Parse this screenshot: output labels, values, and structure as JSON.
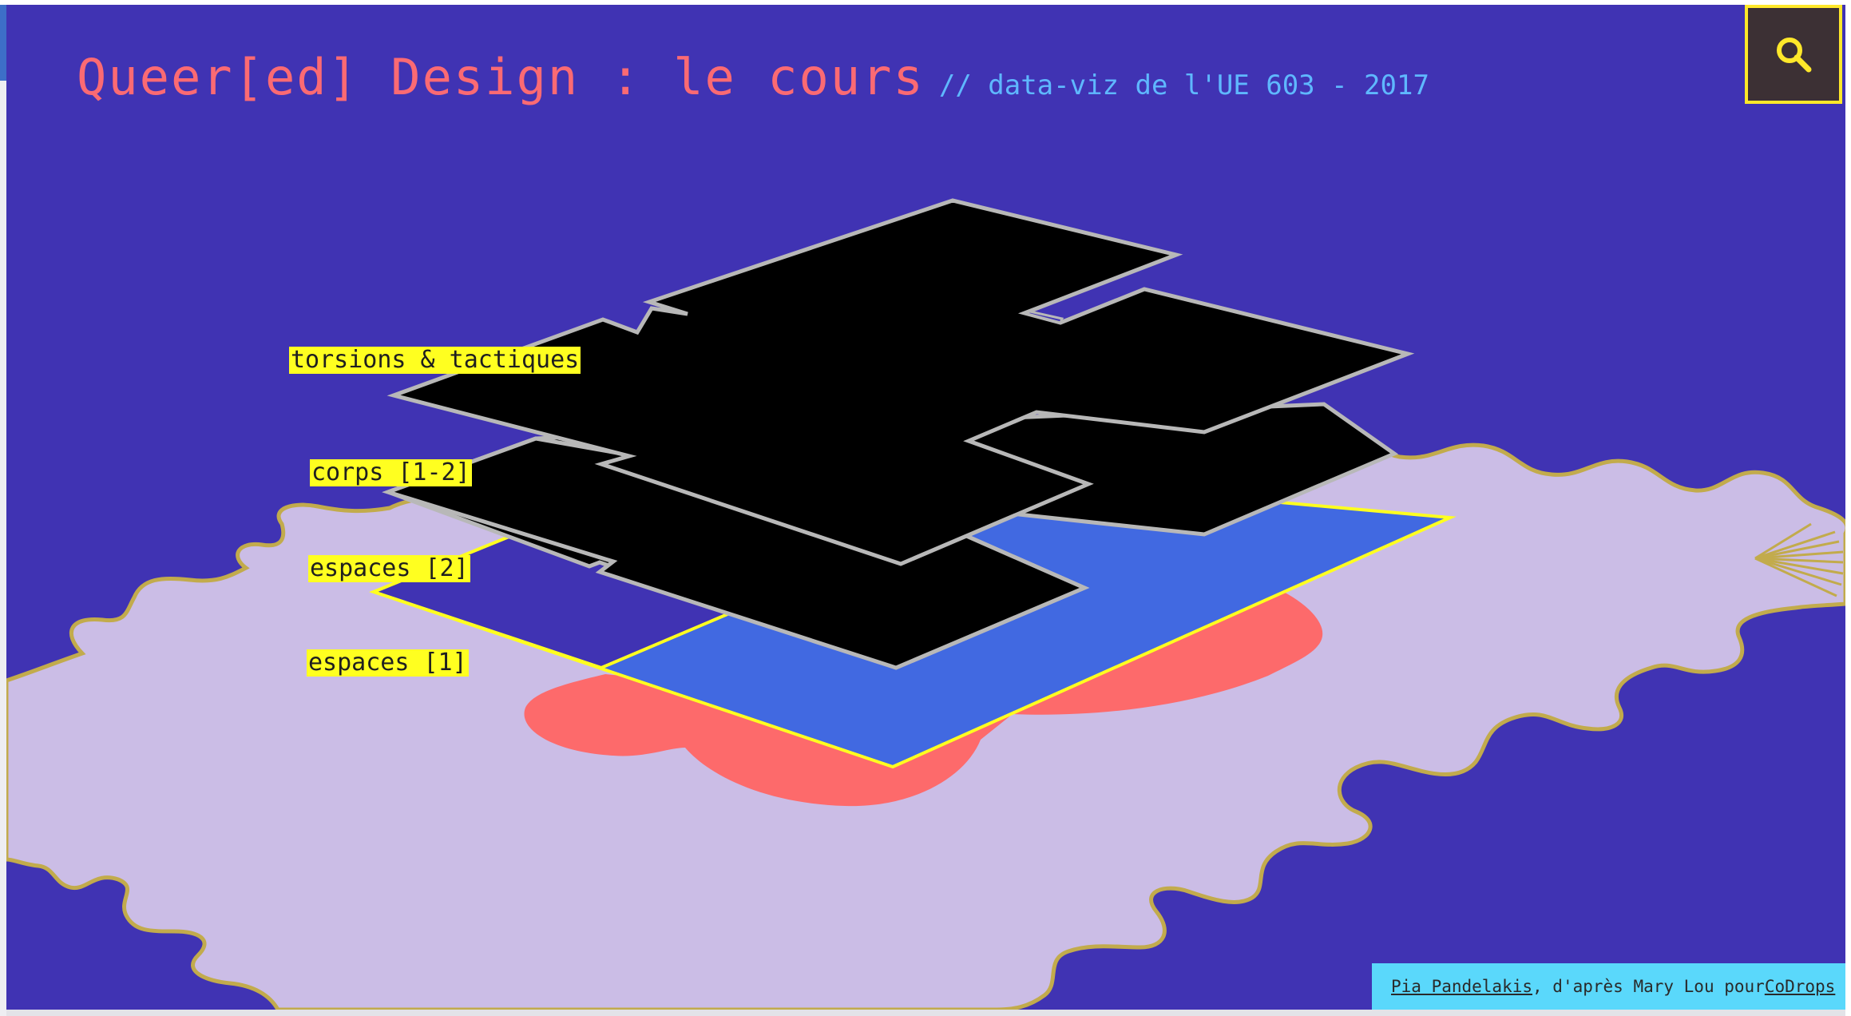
{
  "header": {
    "title": "Queer[ed] Design : le cours",
    "subtitle": "// data-viz de l'UE 603 - 2017"
  },
  "search": {
    "icon": "search-icon"
  },
  "layers": [
    {
      "label": "torsions & tactiques"
    },
    {
      "label": "corps [1-2]"
    },
    {
      "label": "espaces [2]"
    },
    {
      "label": "espaces [1]"
    }
  ],
  "credits": {
    "author": "Pia Pandelakis",
    "middle": ", d'après Mary Lou pour ",
    "source": "CoDrops"
  },
  "colors": {
    "background": "#4033b3",
    "title": "#fb6a73",
    "subtitle": "#5fb8ff",
    "blob": "#cbbde6",
    "blob_outline": "#c2ab4c",
    "coral": "#fd6a6b",
    "blue_layer": "#4169e1",
    "black_layer": "#000000",
    "layer_outline": "#b8b8b8",
    "label_bg": "#ffff20",
    "accent_yellow": "#ffe82a",
    "credits_bg": "#5ad8fb"
  }
}
